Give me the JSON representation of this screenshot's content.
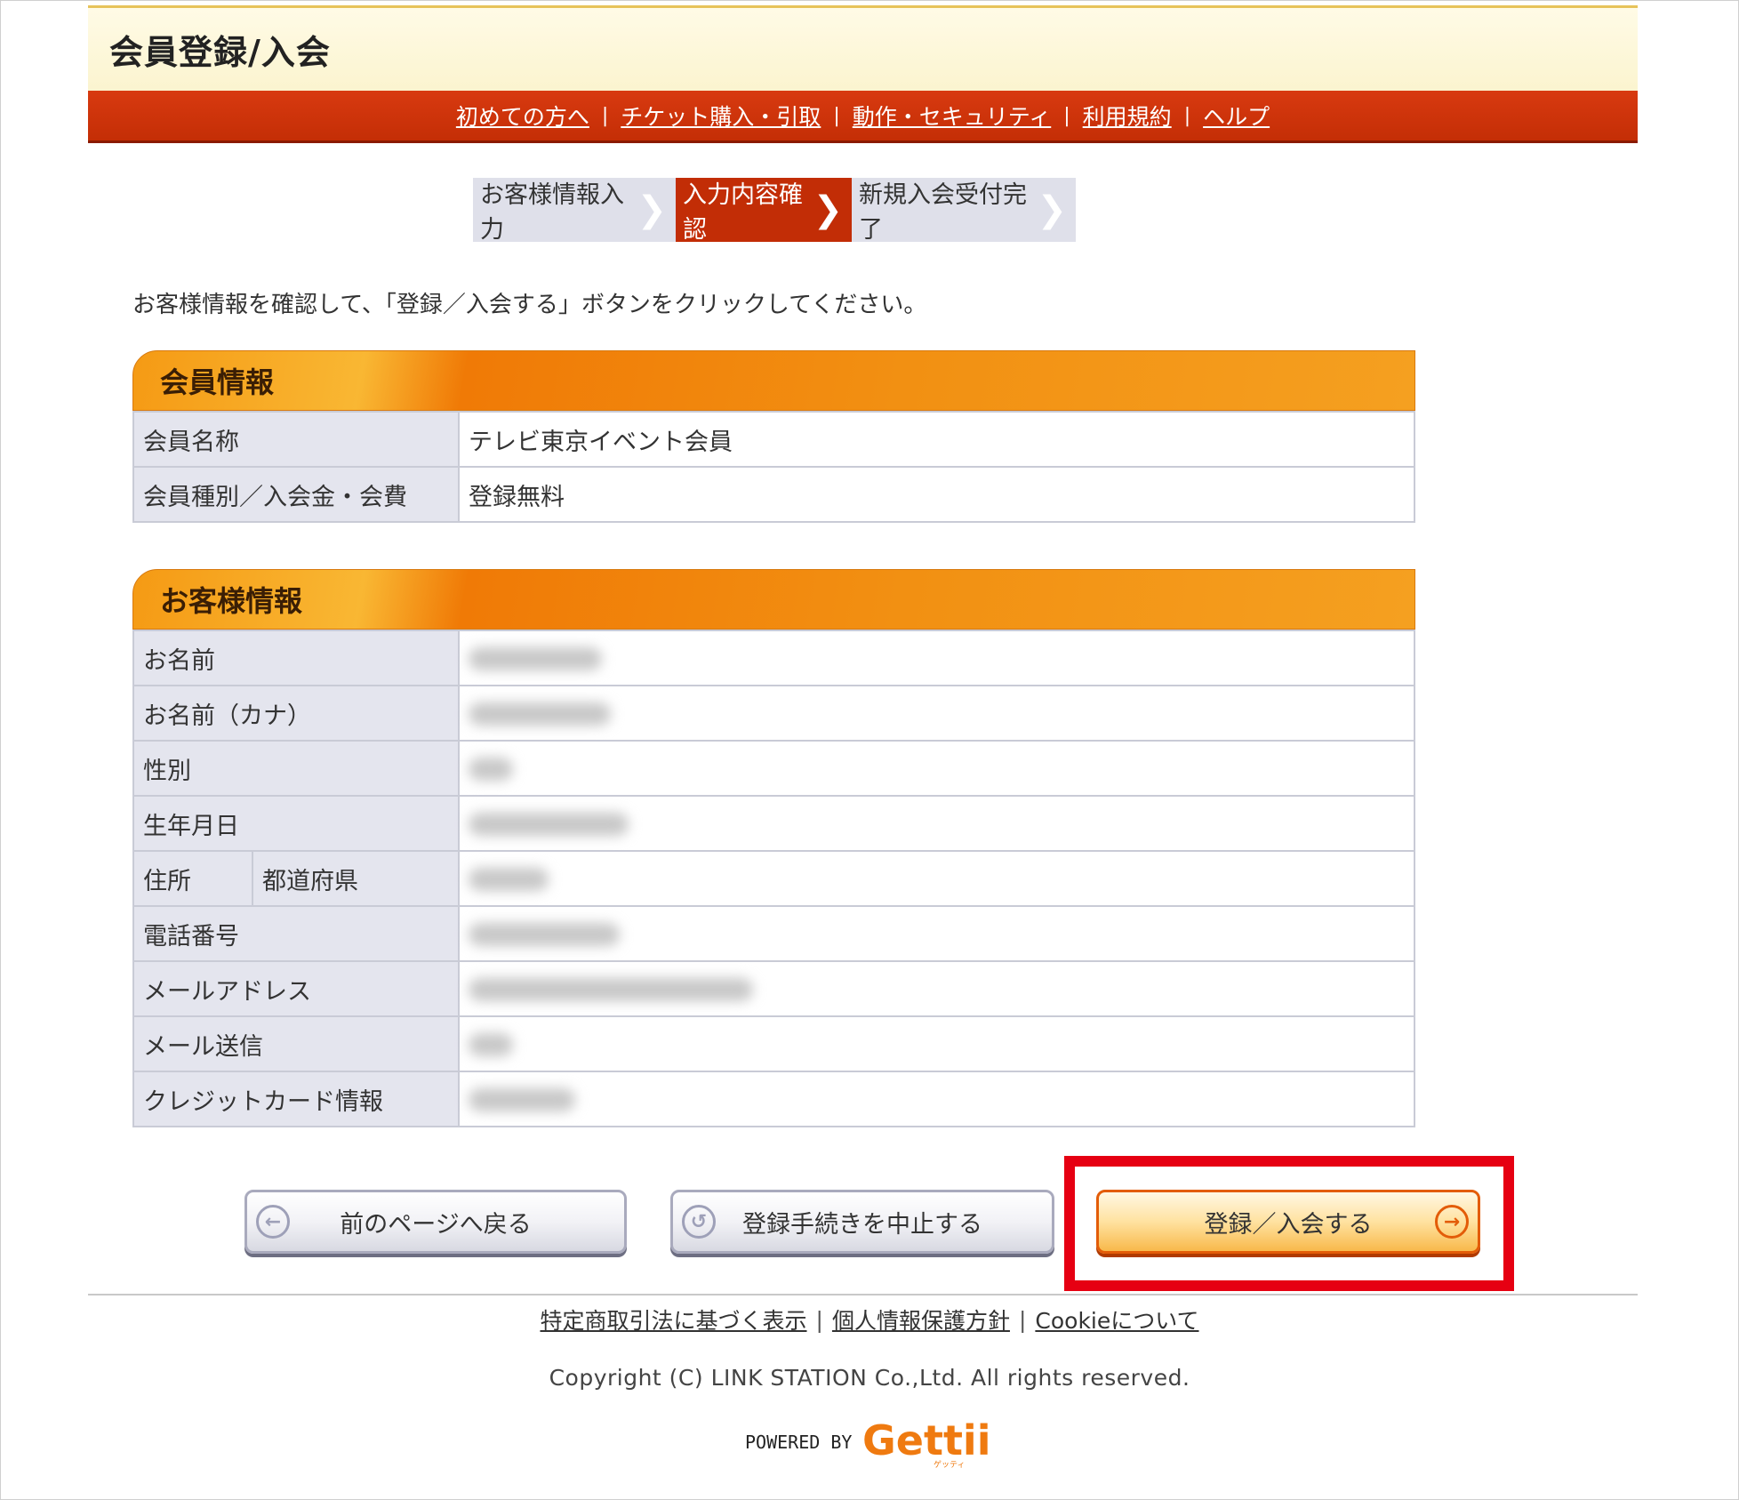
{
  "header": {
    "title": "会員登録/入会"
  },
  "nav": {
    "items": [
      "初めての方へ",
      "チケット購入・引取",
      "動作・セキュリティ",
      "利用規約",
      "ヘルプ"
    ],
    "separator": "|"
  },
  "steps": {
    "items": [
      {
        "label": "お客様情報入力",
        "active": false
      },
      {
        "label": "入力内容確認",
        "active": true
      },
      {
        "label": "新規入会受付完了",
        "active": false
      }
    ]
  },
  "instruction": "お客様情報を確認して、「登録／入会する」ボタンをクリックしてください。",
  "member_info": {
    "title": "会員情報",
    "rows": [
      {
        "label": "会員名称",
        "value": "テレビ東京イベント会員"
      },
      {
        "label": "会員種別／入会金・会費",
        "value": "登録無料"
      }
    ]
  },
  "customer_info": {
    "title": "お客様情報",
    "rows": [
      {
        "label": "お名前"
      },
      {
        "label": "お名前（カナ）"
      },
      {
        "label": "性別"
      },
      {
        "label": "生年月日"
      },
      {
        "label": "住所",
        "sublabel": "都道府県"
      },
      {
        "label": "電話番号"
      },
      {
        "label": "メールアドレス"
      },
      {
        "label": "メール送信"
      },
      {
        "label": "クレジットカード情報"
      }
    ]
  },
  "buttons": {
    "back": "前のページへ戻る",
    "cancel": "登録手続きを中止する",
    "submit": "登録／入会する"
  },
  "footer": {
    "links": [
      "特定商取引法に基づく表示",
      "個人情報保護方針",
      "Cookieについて"
    ],
    "separator": "|",
    "copyright": "Copyright (C) LINK STATION Co.,Ltd. All rights reserved.",
    "powered_by": "POWERED BY",
    "logo_text": "Gettii",
    "logo_kana": "ゲッティ"
  },
  "colors": {
    "nav_red": "#c42e06",
    "section_orange": "#f07a06",
    "highlight_red": "#e60012"
  }
}
